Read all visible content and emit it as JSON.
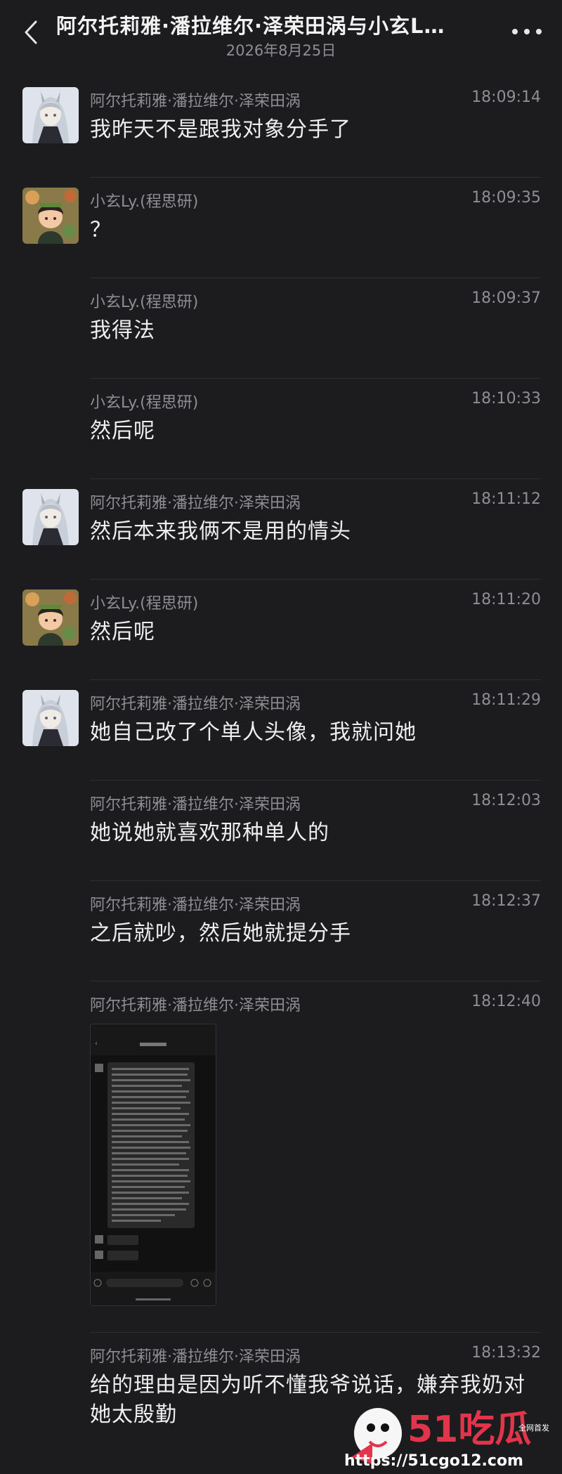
{
  "header": {
    "title": "阿尔托莉雅·潘拉维尔·泽荣田涡与小玄L…",
    "date": "2026年8月25日"
  },
  "messages": [
    {
      "sender": "阿尔托莉雅·潘拉维尔·泽荣田涡",
      "time": "18:09:14",
      "text": "我昨天不是跟我对象分手了",
      "avatar": "girl"
    },
    {
      "sender": "小玄Ly.(程思研)",
      "time": "18:09:35",
      "text": "？",
      "avatar": "boy"
    },
    {
      "sender": "小玄Ly.(程思研)",
      "time": "18:09:37",
      "text": "我得法",
      "avatar": ""
    },
    {
      "sender": "小玄Ly.(程思研)",
      "time": "18:10:33",
      "text": "然后呢",
      "avatar": ""
    },
    {
      "sender": "阿尔托莉雅·潘拉维尔·泽荣田涡",
      "time": "18:11:12",
      "text": "然后本来我俩不是用的情头",
      "avatar": "girl"
    },
    {
      "sender": "小玄Ly.(程思研)",
      "time": "18:11:20",
      "text": "然后呢",
      "avatar": "boy"
    },
    {
      "sender": "阿尔托莉雅·潘拉维尔·泽荣田涡",
      "time": "18:11:29",
      "text": "她自己改了个单人头像，我就问她",
      "avatar": "girl"
    },
    {
      "sender": "阿尔托莉雅·潘拉维尔·泽荣田涡",
      "time": "18:12:03",
      "text": "她说她就喜欢那种单人的",
      "avatar": ""
    },
    {
      "sender": "阿尔托莉雅·潘拉维尔·泽荣田涡",
      "time": "18:12:37",
      "text": "之后就吵，然后她就提分手",
      "avatar": ""
    },
    {
      "sender": "阿尔托莉雅·潘拉维尔·泽荣田涡",
      "time": "18:12:40",
      "text": "",
      "avatar": "",
      "image": true
    },
    {
      "sender": "阿尔托莉雅·潘拉维尔·泽荣田涡",
      "time": "18:13:32",
      "text": "给的理由是因为听不懂我爷说话，嫌弃我奶对她太殷勤",
      "avatar": ""
    }
  ],
  "watermark": {
    "brand": "51吃瓜",
    "url": "https://51cgo12.com",
    "tag": "全网首发"
  },
  "colors": {
    "background": "#1c1c1e",
    "text": "#eeeeee",
    "secondary": "#8e8e93"
  }
}
